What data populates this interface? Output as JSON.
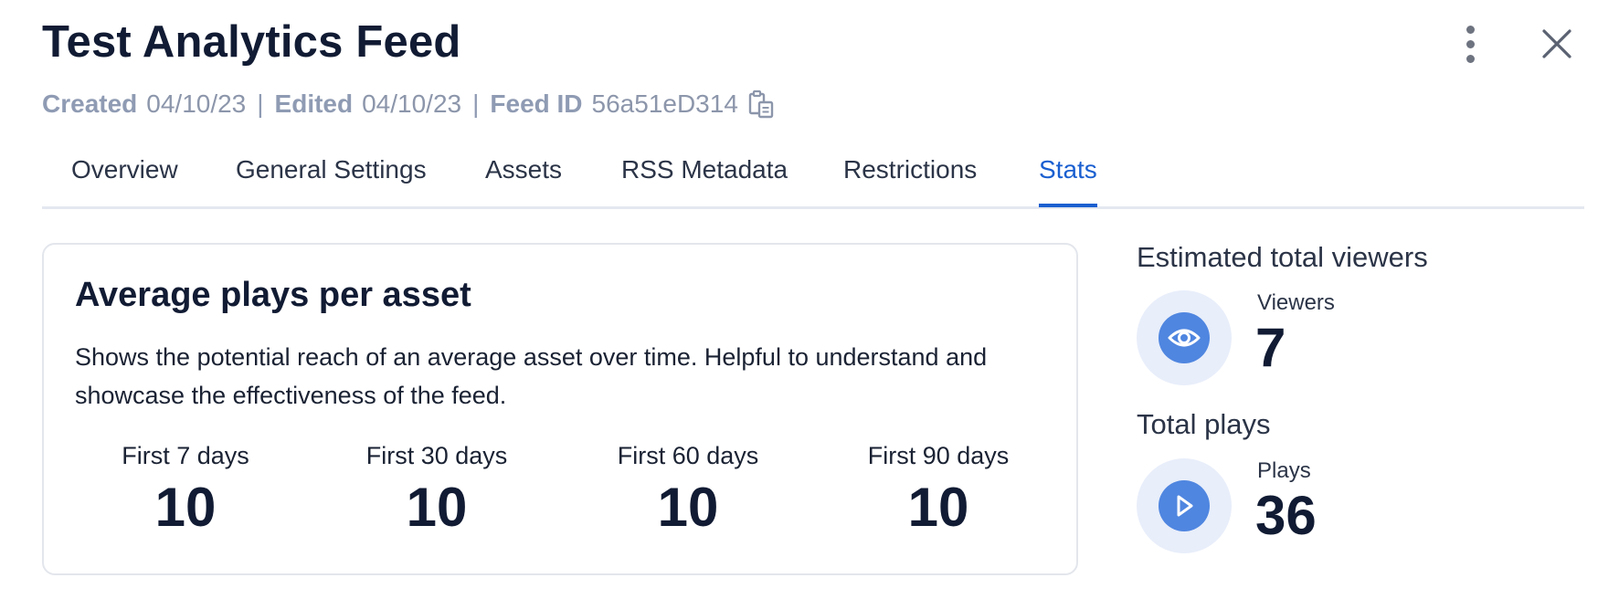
{
  "header": {
    "title": "Test Analytics Feed",
    "meta": {
      "created_label": "Created",
      "created_value": "04/10/23",
      "edited_label": "Edited",
      "edited_value": "04/10/23",
      "feed_id_label": "Feed ID",
      "feed_id_value": "56a51eD314",
      "separator": "|"
    },
    "icons": [
      "kebab-menu-icon",
      "close-icon",
      "clipboard-copy-icon"
    ]
  },
  "tabs": [
    {
      "label": "Overview",
      "active": false
    },
    {
      "label": "General Settings",
      "active": false
    },
    {
      "label": "Assets",
      "active": false
    },
    {
      "label": "RSS Metadata",
      "active": false
    },
    {
      "label": "Restrictions",
      "active": false
    },
    {
      "label": "Stats",
      "active": true
    }
  ],
  "average_plays": {
    "title": "Average plays per asset",
    "description": "Shows the potential reach of an average asset over time. Helpful to understand and showcase the effectiveness of the feed.",
    "periods": [
      {
        "label": "First 7 days",
        "value": "10"
      },
      {
        "label": "First 30 days",
        "value": "10"
      },
      {
        "label": "First 60 days",
        "value": "10"
      },
      {
        "label": "First 90 days",
        "value": "10"
      }
    ]
  },
  "viewers": {
    "title": "Estimated total viewers",
    "label": "Viewers",
    "value": "7",
    "icon": "eye-icon"
  },
  "plays": {
    "title": "Total plays",
    "label": "Plays",
    "value": "36",
    "icon": "play-icon"
  },
  "colors": {
    "accent": "#1a5fd0",
    "icon_circle_bg": "#e8eefa",
    "icon_fill": "#4f86e0",
    "muted_text": "#8c96ab"
  }
}
